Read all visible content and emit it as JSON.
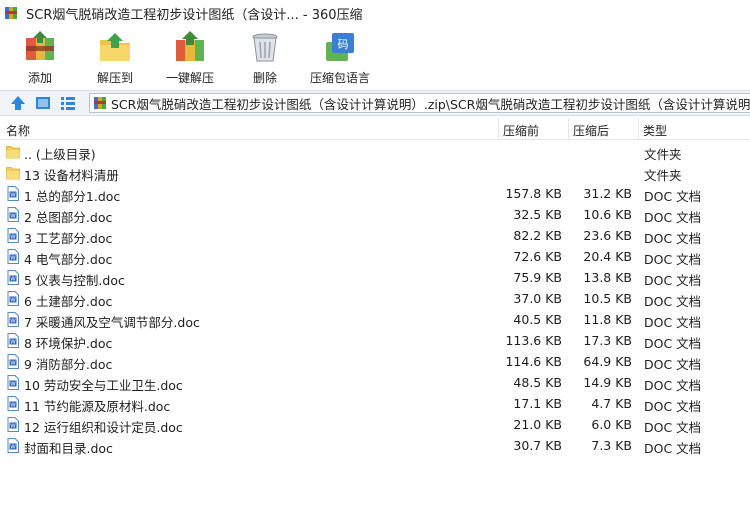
{
  "window": {
    "title": "SCR烟气脱硝改造工程初步设计图纸（含设计... - 360压缩"
  },
  "toolbar": {
    "add_label": "添加",
    "extract_label": "解压到",
    "oneclick_label": "一键解压",
    "delete_label": "删除",
    "encoding_label": "压缩包语言"
  },
  "address": {
    "path": "SCR烟气脱硝改造工程初步设计图纸（含设计计算说明）.zip\\SCR烟气脱硝改造工程初步设计图纸（含设计计算说明）\\文"
  },
  "columns": {
    "name": "名称",
    "size": "压缩前",
    "compressed": "压缩后",
    "type": "类型"
  },
  "rows": [
    {
      "name": ".. (上级目录)",
      "size": "",
      "compressed": "",
      "type": "文件夹",
      "icon": "folder-icon"
    },
    {
      "name": "13 设备材料清册",
      "size": "",
      "compressed": "",
      "type": "文件夹",
      "icon": "folder-icon"
    },
    {
      "name": "1 总的部分1.doc",
      "size": "157.8 KB",
      "compressed": "31.2 KB",
      "type": "DOC 文档",
      "icon": "doc-file-icon"
    },
    {
      "name": "2 总图部分.doc",
      "size": "32.5 KB",
      "compressed": "10.6 KB",
      "type": "DOC 文档",
      "icon": "doc-file-icon"
    },
    {
      "name": "3 工艺部分.doc",
      "size": "82.2 KB",
      "compressed": "23.6 KB",
      "type": "DOC 文档",
      "icon": "doc-file-icon"
    },
    {
      "name": "4 电气部分.doc",
      "size": "72.6 KB",
      "compressed": "20.4 KB",
      "type": "DOC 文档",
      "icon": "doc-file-icon"
    },
    {
      "name": "5 仪表与控制.doc",
      "size": "75.9 KB",
      "compressed": "13.8 KB",
      "type": "DOC 文档",
      "icon": "doc-file-icon"
    },
    {
      "name": "6 土建部分.doc",
      "size": "37.0 KB",
      "compressed": "10.5 KB",
      "type": "DOC 文档",
      "icon": "doc-file-icon"
    },
    {
      "name": "7 采暖通风及空气调节部分.doc",
      "size": "40.5 KB",
      "compressed": "11.8 KB",
      "type": "DOC 文档",
      "icon": "doc-file-icon"
    },
    {
      "name": "8 环境保护.doc",
      "size": "113.6 KB",
      "compressed": "17.3 KB",
      "type": "DOC 文档",
      "icon": "doc-file-icon"
    },
    {
      "name": "9 消防部分.doc",
      "size": "114.6 KB",
      "compressed": "64.9 KB",
      "type": "DOC 文档",
      "icon": "doc-file-icon"
    },
    {
      "name": "10 劳动安全与工业卫生.doc",
      "size": "48.5 KB",
      "compressed": "14.9 KB",
      "type": "DOC 文档",
      "icon": "doc-file-icon"
    },
    {
      "name": "11 节约能源及原材料.doc",
      "size": "17.1 KB",
      "compressed": "4.7 KB",
      "type": "DOC 文档",
      "icon": "doc-file-icon"
    },
    {
      "name": "12 运行组织和设计定员.doc",
      "size": "21.0 KB",
      "compressed": "6.0 KB",
      "type": "DOC 文档",
      "icon": "doc-file-icon"
    },
    {
      "name": "封面和目录.doc",
      "size": "30.7 KB",
      "compressed": "7.3 KB",
      "type": "DOC 文档",
      "icon": "doc-file-icon"
    }
  ]
}
